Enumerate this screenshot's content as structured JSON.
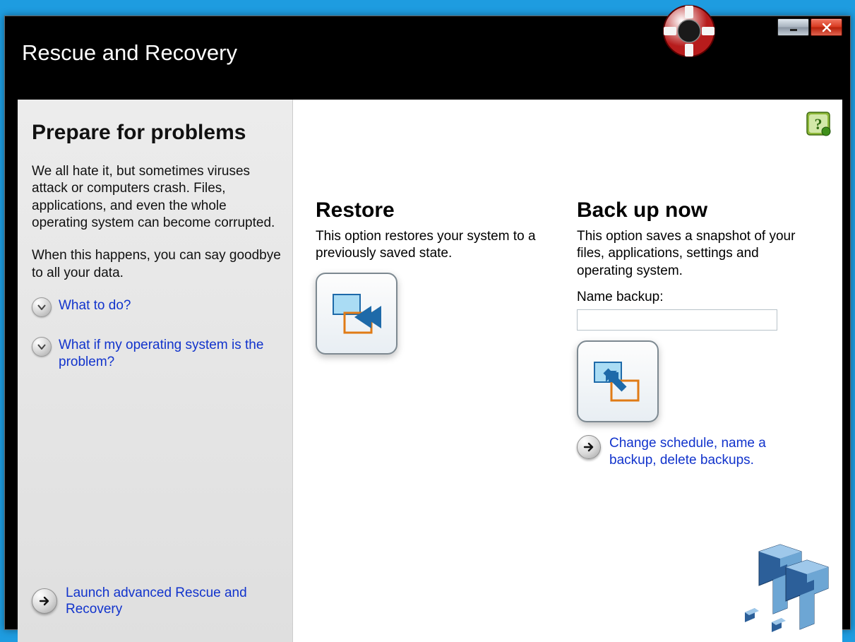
{
  "header": {
    "title": "Rescue and Recovery"
  },
  "sidebar": {
    "heading": "Prepare for problems",
    "para1": "We all hate it, but sometimes viruses attack or computers crash. Files, applications, and even the whole operating system can become corrupted.",
    "para2": "When this happens, you can say goodbye to all your data.",
    "expand1": "What to do?",
    "expand2": "What if my operating system is the problem?",
    "footer_link": "Launch advanced Rescue and Recovery"
  },
  "restore": {
    "heading": "Restore",
    "desc": "This option restores your system to a previously saved state."
  },
  "backup": {
    "heading": "Back up now",
    "desc": "This option saves a snapshot of your files, applications, settings and operating system.",
    "field_label": "Name backup:",
    "field_value": "",
    "change_link": "Change schedule, name a backup, delete backups."
  }
}
